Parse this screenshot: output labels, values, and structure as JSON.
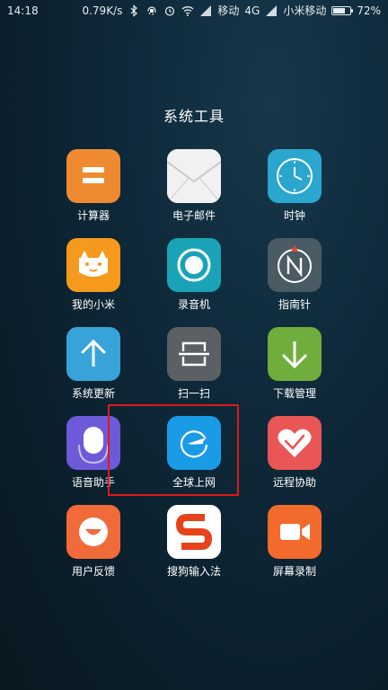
{
  "status_bar": {
    "time": "14:18",
    "speed": "0.79K/s",
    "carrier1": "移动",
    "network": "4G",
    "carrier2": "小米移动",
    "battery_text": "72%",
    "battery_level": 0.72
  },
  "folder": {
    "title": "系统工具"
  },
  "apps": [
    {
      "label": "计算器",
      "icon": "calculator-icon",
      "color": "#f08a30"
    },
    {
      "label": "电子邮件",
      "icon": "envelope-icon",
      "color": "#f4f4f4"
    },
    {
      "label": "时钟",
      "icon": "clock-icon",
      "color": "#2aa6cf"
    },
    {
      "label": "我的小米",
      "icon": "mi-bunny-icon",
      "color": "#f59a1c"
    },
    {
      "label": "录音机",
      "icon": "record-icon",
      "color": "#1aa3b7"
    },
    {
      "label": "指南针",
      "icon": "compass-icon",
      "color": "#4a5b63"
    },
    {
      "label": "系统更新",
      "icon": "arrow-up-icon",
      "color": "#37a3d9"
    },
    {
      "label": "扫一扫",
      "icon": "scan-icon",
      "color": "#5a6064"
    },
    {
      "label": "下载管理",
      "icon": "arrow-down-icon",
      "color": "#6fae3c"
    },
    {
      "label": "语音助手",
      "icon": "microphone-icon",
      "color": "#6d5ad8"
    },
    {
      "label": "全球上网",
      "icon": "airplane-globe-icon",
      "color": "#1a9be6"
    },
    {
      "label": "远程协助",
      "icon": "heart-icon",
      "color": "#ea5556"
    },
    {
      "label": "用户反馈",
      "icon": "smiley-icon",
      "color": "#f06a3a"
    },
    {
      "label": "搜狗输入法",
      "icon": "sogou-s-icon",
      "color": "#ffffff"
    },
    {
      "label": "屏幕录制",
      "icon": "video-camera-icon",
      "color": "#f26a2c"
    }
  ],
  "highlight_color": "#e01818"
}
